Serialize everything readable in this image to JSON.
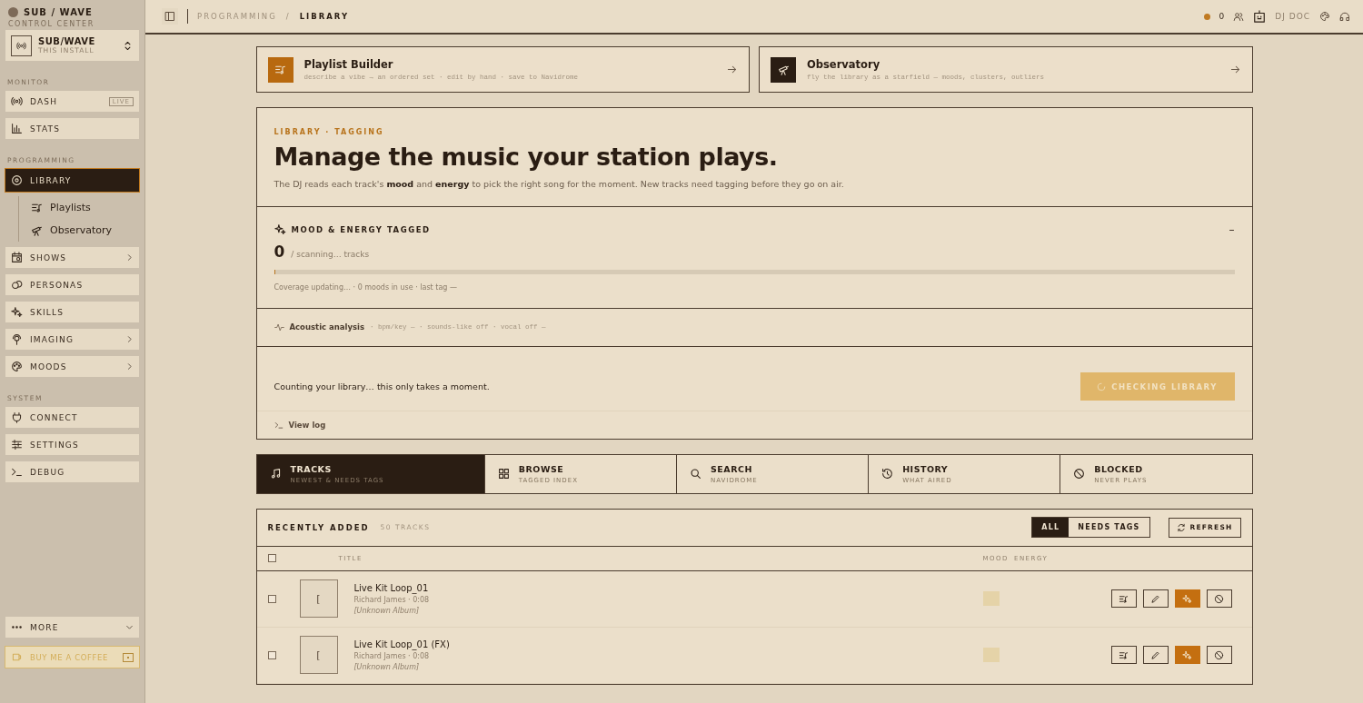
{
  "sidebar": {
    "brand": {
      "title": "SUB / WAVE",
      "subtitle": "CONTROL CENTER"
    },
    "install": {
      "title": "SUB/WAVE",
      "subtitle": "THIS INSTALL"
    },
    "sections": [
      {
        "heading": "MONITOR",
        "items": [
          {
            "label": "DASH",
            "selected": false,
            "expandable": false,
            "badge": "LIVE"
          },
          {
            "label": "STATS",
            "selected": false,
            "expandable": false
          }
        ]
      },
      {
        "heading": "PROGRAMMING",
        "items": [
          {
            "label": "LIBRARY",
            "selected": true,
            "expandable": false,
            "children": [
              {
                "label": "Playlists"
              },
              {
                "label": "Observatory"
              }
            ]
          },
          {
            "label": "SHOWS",
            "selected": false,
            "expandable": true
          },
          {
            "label": "PERSONAS",
            "selected": false,
            "expandable": false
          },
          {
            "label": "SKILLS",
            "selected": false,
            "expandable": false
          },
          {
            "label": "IMAGING",
            "selected": false,
            "expandable": true
          },
          {
            "label": "MOODS",
            "selected": false,
            "expandable": true
          }
        ]
      },
      {
        "heading": "SYSTEM",
        "items": [
          {
            "label": "CONNECT",
            "selected": false,
            "expandable": false
          },
          {
            "label": "SETTINGS",
            "selected": false,
            "expandable": false
          },
          {
            "label": "DEBUG",
            "selected": false,
            "expandable": false
          }
        ]
      }
    ],
    "more": "MORE",
    "coffee": "BUY ME A COFFEE"
  },
  "topbar": {
    "breadcrumb": {
      "parent": "PROGRAMMING",
      "separator": "/",
      "current": "LIBRARY"
    },
    "listeners": "0",
    "dj": "DJ DOC"
  },
  "cards": [
    {
      "title": "Playlist Builder",
      "subtitle": "describe a vibe → an ordered set · edit by hand · save to Navidrome",
      "color": "#b8690f"
    },
    {
      "title": "Observatory",
      "subtitle": "fly the library as a starfield — moods, clusters, outliers",
      "color": "#2a1d13"
    }
  ],
  "hero": {
    "eyebrow": "LIBRARY · TAGGING",
    "title": "Manage the music your station plays.",
    "description": "The DJ reads each track's **mood** and **energy** to pick the right song for the moment. New tracks need tagging before they go on air."
  },
  "tagging": {
    "heading": "MOOD & ENERGY TAGGED",
    "count": "0",
    "count_suffix": "/ scanning… tracks",
    "level": 0,
    "collapse": "–",
    "coverage": "Coverage updating… · 0 moods in use · last tag —"
  },
  "acoustic": {
    "label": "Acoustic analysis",
    "details": "· bpm/key — · sounds-like off · vocal off —"
  },
  "status": {
    "message": "Counting your library… this only takes a moment.",
    "button": {
      "label": "CHECKING LIBRARY",
      "disabled": true
    },
    "log_link": "View log"
  },
  "tabs": [
    {
      "label": "TRACKS",
      "sublabel": "NEWEST & NEEDS TAGS",
      "selected": true
    },
    {
      "label": "BROWSE",
      "sublabel": "TAGGED INDEX",
      "selected": false
    },
    {
      "label": "SEARCH",
      "sublabel": "NAVIDROME",
      "selected": false
    },
    {
      "label": "HISTORY",
      "sublabel": "WHAT AIRED",
      "selected": false
    },
    {
      "label": "BLOCKED",
      "sublabel": "NEVER PLAYS",
      "selected": false
    }
  ],
  "table": {
    "title": "RECENTLY ADDED",
    "count": "50 TRACKS",
    "filters": [
      {
        "label": "ALL",
        "selected": true
      },
      {
        "label": "NEEDS TAGS",
        "selected": false
      }
    ],
    "refresh": "REFRESH",
    "select_all_checked": false,
    "columns": [
      "TITLE",
      "MOOD",
      "ENERGY"
    ],
    "rows": [
      {
        "checked": false,
        "art": "[",
        "title": "Live Kit Loop_01",
        "meta": "Richard James · 0:08",
        "album": "[Unknown Album]"
      },
      {
        "checked": false,
        "art": "[",
        "title": "Live Kit Loop_01 (FX)",
        "meta": "Richard James · 0:08",
        "album": "[Unknown Album]"
      }
    ]
  }
}
